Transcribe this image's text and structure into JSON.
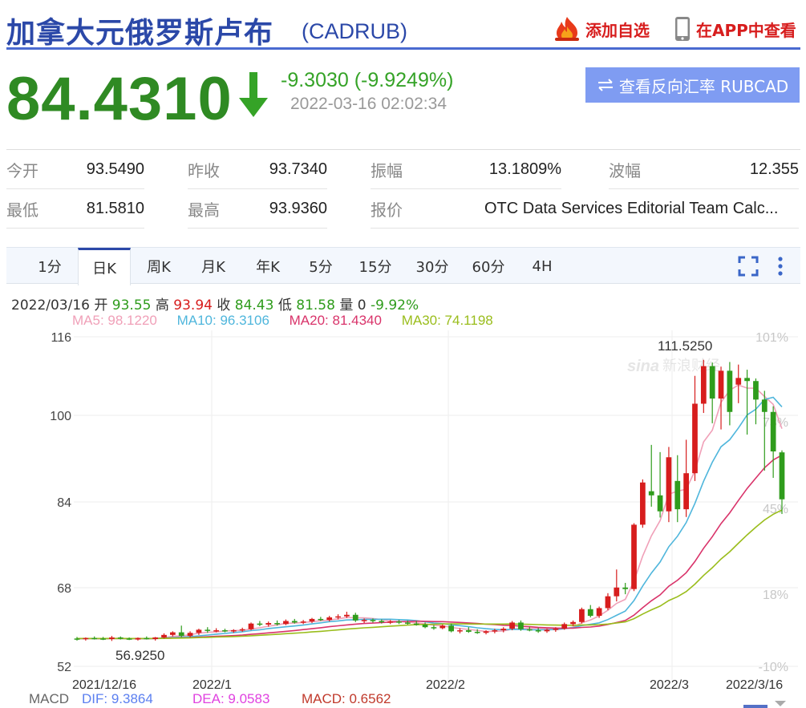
{
  "header": {
    "title": "加拿大元俄罗斯卢布",
    "code": "(CADRUB)",
    "favorite_label": "添加自选",
    "app_label": "在APP中查看"
  },
  "quote": {
    "price": "84.4310",
    "change": "-9.3030 (-9.9249%)",
    "time": "2022-03-16 02:02:34",
    "reverse_label": "查看反向汇率 RUBCAD"
  },
  "stats": [
    {
      "label": "今开",
      "value": "93.5490"
    },
    {
      "label": "昨收",
      "value": "93.7340"
    },
    {
      "label": "振幅",
      "value": "13.1809%"
    },
    {
      "label": "波幅",
      "value": "12.355"
    },
    {
      "label": "最低",
      "value": "81.5810"
    },
    {
      "label": "最高",
      "value": "93.9360"
    },
    {
      "label": "报价",
      "value": "OTC Data Services Editorial Team Calc..."
    }
  ],
  "tabs": [
    "1分",
    "日K",
    "周K",
    "月K",
    "年K",
    "5分",
    "15分",
    "30分",
    "60分",
    "4H"
  ],
  "active_tab": "日K",
  "info": {
    "date": "2022/03/16",
    "open_lbl": "开",
    "open": "93.55",
    "high_lbl": "高",
    "high": "93.94",
    "close_lbl": "收",
    "close": "84.43",
    "low_lbl": "低",
    "low": "81.58",
    "vol_lbl": "量",
    "vol": "0",
    "chg": "-9.92%"
  },
  "ma": {
    "ma5": "MA5: 98.1220",
    "ma10": "MA10: 96.3106",
    "ma20": "MA20: 81.4340",
    "ma30": "MA30: 74.1198"
  },
  "macd": {
    "label": "MACD",
    "dif": "DIF: 9.3864",
    "dea": "DEA: 9.0583",
    "macd": "MACD: 0.6562"
  },
  "watermark": "新浪财经",
  "colors": {
    "up": "#d71d1d",
    "down": "#2f9c1c",
    "ma5": "#f0a0b8",
    "ma10": "#4fb6dc",
    "ma20": "#d9336a",
    "ma30": "#9abd1c",
    "brand": "#2b48a8"
  },
  "chart_data": {
    "type": "candlestick",
    "y_ticks": [
      "116",
      "100",
      "84",
      "68",
      "52"
    ],
    "ylim": [
      52,
      116
    ],
    "pct_ticks": [
      "101%",
      "73%",
      "45%",
      "18%",
      "-10%"
    ],
    "x_ticks": [
      "2021/12/16",
      "2022/1",
      "2022/2",
      "2022/3",
      "2022/3/16"
    ],
    "annotations": {
      "max": "111.5250",
      "min": "56.9250"
    },
    "candles": [
      {
        "o": 57.4,
        "h": 57.7,
        "l": 57.0,
        "c": 57.3
      },
      {
        "o": 57.3,
        "h": 57.6,
        "l": 57.0,
        "c": 57.5
      },
      {
        "o": 57.5,
        "h": 57.8,
        "l": 57.2,
        "c": 57.4
      },
      {
        "o": 57.4,
        "h": 57.7,
        "l": 57.1,
        "c": 57.3
      },
      {
        "o": 57.3,
        "h": 57.9,
        "l": 56.925,
        "c": 57.6
      },
      {
        "o": 57.6,
        "h": 57.8,
        "l": 57.2,
        "c": 57.4
      },
      {
        "o": 57.4,
        "h": 57.6,
        "l": 57.1,
        "c": 57.2
      },
      {
        "o": 57.2,
        "h": 57.6,
        "l": 57.0,
        "c": 57.5
      },
      {
        "o": 57.5,
        "h": 57.8,
        "l": 57.2,
        "c": 57.3
      },
      {
        "o": 57.3,
        "h": 57.7,
        "l": 57.0,
        "c": 57.6
      },
      {
        "o": 57.6,
        "h": 58.4,
        "l": 57.4,
        "c": 58.1
      },
      {
        "o": 58.1,
        "h": 58.8,
        "l": 57.8,
        "c": 58.6
      },
      {
        "o": 58.6,
        "h": 59.9,
        "l": 57.6,
        "c": 57.9
      },
      {
        "o": 57.9,
        "h": 58.8,
        "l": 57.6,
        "c": 58.5
      },
      {
        "o": 58.5,
        "h": 59.3,
        "l": 58.1,
        "c": 59.1
      },
      {
        "o": 59.1,
        "h": 59.6,
        "l": 58.5,
        "c": 58.9
      },
      {
        "o": 58.9,
        "h": 59.4,
        "l": 58.6,
        "c": 59.0
      },
      {
        "o": 59.0,
        "h": 59.3,
        "l": 58.6,
        "c": 58.8
      },
      {
        "o": 58.8,
        "h": 59.2,
        "l": 58.5,
        "c": 59.0
      },
      {
        "o": 59.0,
        "h": 59.5,
        "l": 58.7,
        "c": 59.2
      },
      {
        "o": 59.2,
        "h": 60.5,
        "l": 59.0,
        "c": 60.3
      },
      {
        "o": 60.3,
        "h": 60.8,
        "l": 59.8,
        "c": 60.1
      },
      {
        "o": 60.1,
        "h": 60.7,
        "l": 59.7,
        "c": 60.4
      },
      {
        "o": 60.4,
        "h": 60.9,
        "l": 59.9,
        "c": 60.2
      },
      {
        "o": 60.2,
        "h": 61.1,
        "l": 60.0,
        "c": 60.8
      },
      {
        "o": 60.8,
        "h": 61.2,
        "l": 60.3,
        "c": 60.5
      },
      {
        "o": 60.5,
        "h": 61.0,
        "l": 60.2,
        "c": 60.7
      },
      {
        "o": 60.7,
        "h": 61.4,
        "l": 60.4,
        "c": 61.2
      },
      {
        "o": 61.2,
        "h": 61.6,
        "l": 60.8,
        "c": 61.0
      },
      {
        "o": 61.0,
        "h": 61.8,
        "l": 60.7,
        "c": 61.5
      },
      {
        "o": 61.5,
        "h": 62.1,
        "l": 61.1,
        "c": 61.7
      },
      {
        "o": 61.7,
        "h": 62.6,
        "l": 61.4,
        "c": 62.0
      },
      {
        "o": 62.0,
        "h": 62.4,
        "l": 60.6,
        "c": 60.9
      },
      {
        "o": 60.9,
        "h": 61.3,
        "l": 60.4,
        "c": 61.0
      },
      {
        "o": 61.0,
        "h": 61.3,
        "l": 60.5,
        "c": 60.8
      },
      {
        "o": 60.8,
        "h": 61.1,
        "l": 60.3,
        "c": 60.6
      },
      {
        "o": 60.6,
        "h": 61.0,
        "l": 60.2,
        "c": 60.7
      },
      {
        "o": 60.7,
        "h": 61.0,
        "l": 60.2,
        "c": 60.5
      },
      {
        "o": 60.5,
        "h": 60.9,
        "l": 60.1,
        "c": 60.3
      },
      {
        "o": 60.3,
        "h": 60.8,
        "l": 59.9,
        "c": 60.1
      },
      {
        "o": 60.1,
        "h": 60.5,
        "l": 59.4,
        "c": 59.6
      },
      {
        "o": 59.6,
        "h": 60.0,
        "l": 59.1,
        "c": 59.4
      },
      {
        "o": 59.4,
        "h": 60.1,
        "l": 59.2,
        "c": 59.9
      },
      {
        "o": 59.9,
        "h": 60.3,
        "l": 58.6,
        "c": 58.8
      },
      {
        "o": 58.8,
        "h": 59.4,
        "l": 58.4,
        "c": 59.0
      },
      {
        "o": 59.0,
        "h": 59.6,
        "l": 58.5,
        "c": 58.7
      },
      {
        "o": 58.7,
        "h": 59.2,
        "l": 58.3,
        "c": 58.5
      },
      {
        "o": 58.5,
        "h": 59.0,
        "l": 58.2,
        "c": 58.8
      },
      {
        "o": 58.8,
        "h": 59.3,
        "l": 58.4,
        "c": 59.0
      },
      {
        "o": 59.0,
        "h": 59.6,
        "l": 58.6,
        "c": 59.3
      },
      {
        "o": 59.3,
        "h": 60.8,
        "l": 59.0,
        "c": 60.5
      },
      {
        "o": 60.5,
        "h": 60.9,
        "l": 58.9,
        "c": 59.2
      },
      {
        "o": 59.2,
        "h": 59.7,
        "l": 58.8,
        "c": 59.0
      },
      {
        "o": 59.0,
        "h": 59.5,
        "l": 58.5,
        "c": 58.8
      },
      {
        "o": 58.8,
        "h": 59.3,
        "l": 58.5,
        "c": 59.1
      },
      {
        "o": 59.1,
        "h": 59.6,
        "l": 58.7,
        "c": 59.3
      },
      {
        "o": 59.3,
        "h": 60.5,
        "l": 59.1,
        "c": 60.2
      },
      {
        "o": 60.2,
        "h": 60.9,
        "l": 59.8,
        "c": 60.6
      },
      {
        "o": 60.6,
        "h": 63.4,
        "l": 60.3,
        "c": 63.1
      },
      {
        "o": 63.1,
        "h": 63.9,
        "l": 61.5,
        "c": 61.8
      },
      {
        "o": 61.8,
        "h": 63.6,
        "l": 61.4,
        "c": 63.3
      },
      {
        "o": 63.3,
        "h": 66.2,
        "l": 62.9,
        "c": 65.6
      },
      {
        "o": 65.6,
        "h": 70.8,
        "l": 64.6,
        "c": 67.3
      },
      {
        "o": 67.3,
        "h": 68.2,
        "l": 66.0,
        "c": 67.0
      },
      {
        "o": 67.0,
        "h": 79.8,
        "l": 66.6,
        "c": 79.5
      },
      {
        "o": 79.5,
        "h": 88.3,
        "l": 78.9,
        "c": 87.7
      },
      {
        "o": 86.0,
        "h": 95.0,
        "l": 83.0,
        "c": 85.2
      },
      {
        "o": 85.2,
        "h": 93.6,
        "l": 80.9,
        "c": 82.1
      },
      {
        "o": 82.1,
        "h": 94.6,
        "l": 80.0,
        "c": 92.6
      },
      {
        "o": 88.0,
        "h": 93.0,
        "l": 80.0,
        "c": 82.5
      },
      {
        "o": 82.5,
        "h": 96.0,
        "l": 81.0,
        "c": 89.5
      },
      {
        "o": 89.5,
        "h": 108.4,
        "l": 88.0,
        "c": 103.0
      },
      {
        "o": 103.0,
        "h": 111.525,
        "l": 101.2,
        "c": 110.3
      },
      {
        "o": 110.3,
        "h": 111.0,
        "l": 99.2,
        "c": 104.0
      },
      {
        "o": 104.0,
        "h": 110.2,
        "l": 98.0,
        "c": 109.4
      },
      {
        "o": 109.4,
        "h": 111.1,
        "l": 98.8,
        "c": 101.4
      },
      {
        "o": 106.7,
        "h": 110.6,
        "l": 103.1,
        "c": 108.0
      },
      {
        "o": 108.0,
        "h": 109.6,
        "l": 97.0,
        "c": 107.4
      },
      {
        "o": 107.4,
        "h": 107.9,
        "l": 99.0,
        "c": 103.8
      },
      {
        "o": 103.8,
        "h": 105.5,
        "l": 90.0,
        "c": 101.4
      },
      {
        "o": 101.4,
        "h": 102.5,
        "l": 88.6,
        "c": 93.734
      },
      {
        "o": 93.549,
        "h": 93.936,
        "l": 81.581,
        "c": 84.431
      }
    ],
    "ma5_last": 98.122,
    "ma10_last": 96.3106,
    "ma20_last": 81.434,
    "ma30_last": 74.1198
  }
}
